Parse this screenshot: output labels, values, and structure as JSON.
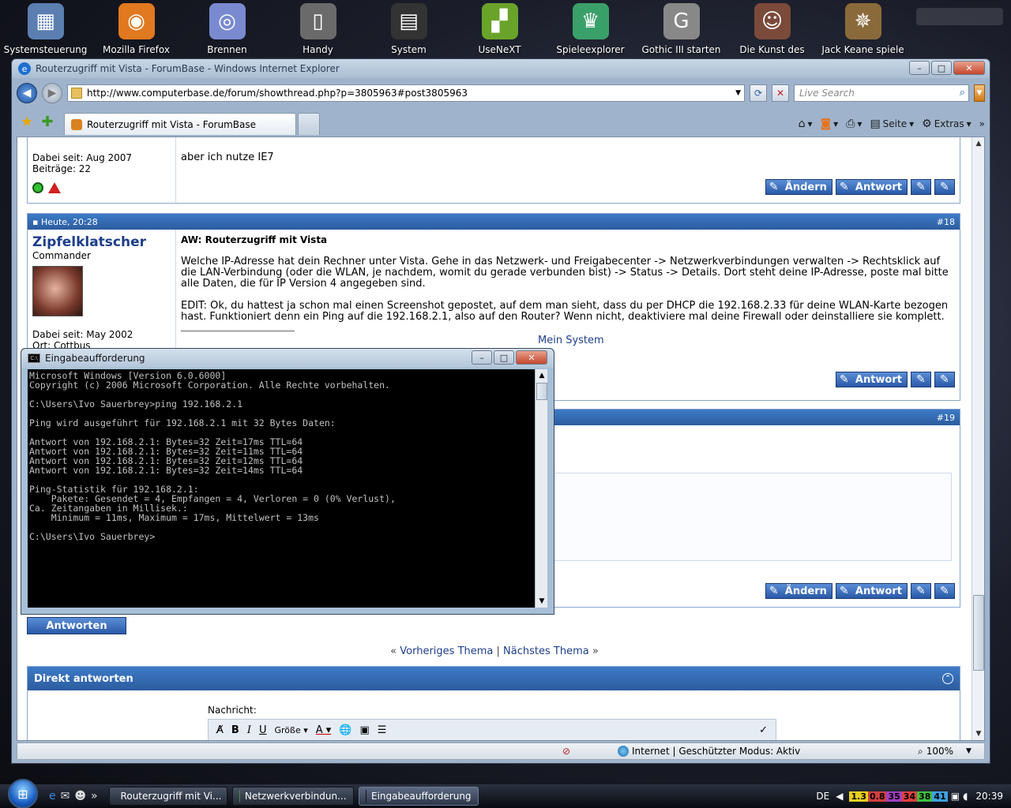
{
  "desktop": {
    "icons": [
      {
        "label": "Systemsteuerung",
        "icon": "control-panel-icon",
        "color": "#5a7fb0",
        "glyph": "▦"
      },
      {
        "label": "Mozilla Firefox",
        "icon": "firefox-icon",
        "color": "#e0791f",
        "glyph": "◉"
      },
      {
        "label": "Brennen",
        "icon": "disc-icon",
        "color": "#7a8ad0",
        "glyph": "◎"
      },
      {
        "label": "Handy",
        "icon": "phone-icon",
        "color": "#6a6a6a",
        "glyph": "▯"
      },
      {
        "label": "System",
        "icon": "chip-icon",
        "color": "#333333",
        "glyph": "▤"
      },
      {
        "label": "UseNeXT",
        "icon": "usenext-icon",
        "color": "#6aa32a",
        "glyph": "▞"
      },
      {
        "label": "Spieleexplorer",
        "icon": "trophy-icon",
        "color": "#3aa06a",
        "glyph": "♛"
      },
      {
        "label": "Gothic III starten",
        "icon": "gothic-icon",
        "color": "#888888",
        "glyph": "G"
      },
      {
        "label": "Die Kunst des",
        "icon": "game-portrait-icon",
        "color": "#7a4a3a",
        "glyph": "☺"
      },
      {
        "label": "Jack Keane spiele",
        "icon": "compass-icon",
        "color": "#8a6a3a",
        "glyph": "✵"
      }
    ]
  },
  "ie": {
    "title": "Routerzugriff mit Vista - ForumBase - Windows Internet Explorer",
    "url": "http://www.computerbase.de/forum/showthread.php?p=3805963#post3805963",
    "search_placeholder": "Live Search",
    "tab_label": "Routerzugriff mit Vista - ForumBase",
    "cmd": {
      "seite": "Seite",
      "extras": "Extras"
    },
    "status": {
      "zone": "Internet | Geschützter Modus: Aktiv",
      "zoom": "100%"
    }
  },
  "forum": {
    "post17": {
      "member_since": "Dabei seit: Aug 2007",
      "posts": "Beiträge: 22",
      "message": "aber ich nutze IE7",
      "btn_edit": "Ändern",
      "btn_reply": "Antwort"
    },
    "post18": {
      "date": "Heute, 20:28",
      "number": "#18",
      "username": "Zipfelklatscher",
      "rank": "Commander",
      "member_since": "Dabei seit: May 2002",
      "location": "Ort: Cottbus",
      "subject": "AW: Routerzugriff mit Vista",
      "para1": "Welche IP-Adresse hat dein Rechner unter Vista. Gehe in das Netzwerk- und Freigabecenter -> Netzwerkverbindungen verwalten -> Rechtsklick auf die LAN-Verbindung (oder die WLAN, je nachdem, womit du gerade verbunden bist) -> Status -> Details. Dort steht deine IP-Adresse, poste mal bitte alle Daten, die für IP Version 4 angegeben sind.",
      "para2": "EDIT: Ok, du hattest ja schon mal einen Screenshot gepostet, auf dem man sieht, dass du per DHCP die 192.168.2.33 für deine WLAN-Karte bezogen hast. Funktioniert denn ein Ping auf die 192.168.2.1, also auf den Router? Wenn nicht, deaktiviere mal deine Firewall oder deinstalliere sie komplett.",
      "sig_link": "Mein System",
      "btn_reply": "Antwort"
    },
    "post19": {
      "number": "#19",
      "btn_edit": "Ändern",
      "btn_reply": "Antwort"
    },
    "antworten": "Antworten",
    "prev_thread": "Vorheriges Thema",
    "next_thread": "Nächstes Thema",
    "direkt_title": "Direkt antworten",
    "nachricht": "Nachricht:",
    "size_label": "Größe"
  },
  "cmd": {
    "title": "Eingabeaufforderung",
    "lines": [
      "Microsoft Windows [Version 6.0.6000]",
      "Copyright (c) 2006 Microsoft Corporation. Alle Rechte vorbehalten.",
      "",
      "C:\\Users\\Ivo Sauerbrey>ping 192.168.2.1",
      "",
      "Ping wird ausgeführt für 192.168.2.1 mit 32 Bytes Daten:",
      "",
      "Antwort von 192.168.2.1: Bytes=32 Zeit=17ms TTL=64",
      "Antwort von 192.168.2.1: Bytes=32 Zeit=11ms TTL=64",
      "Antwort von 192.168.2.1: Bytes=32 Zeit=12ms TTL=64",
      "Antwort von 192.168.2.1: Bytes=32 Zeit=14ms TTL=64",
      "",
      "Ping-Statistik für 192.168.2.1:",
      "    Pakete: Gesendet = 4, Empfangen = 4, Verloren = 0 (0% Verlust),",
      "Ca. Zeitangaben in Millisek.:",
      "    Minimum = 11ms, Maximum = 17ms, Mittelwert = 13ms",
      "",
      "C:\\Users\\Ivo Sauerbrey>"
    ]
  },
  "taskbar": {
    "tasks": [
      {
        "label": "Routerzugriff mit Vi...",
        "color": "#2a6ad0"
      },
      {
        "label": "Netzwerkverbindun...",
        "color": "#4a8a4a"
      },
      {
        "label": "Eingabeaufforderung",
        "color": "#111111"
      }
    ],
    "lang": "DE",
    "tray_nums": [
      {
        "value": "1.3",
        "color": "#e8d020"
      },
      {
        "value": "0.8",
        "color": "#d04040"
      },
      {
        "value": "35",
        "color": "#a040c0"
      },
      {
        "value": "34",
        "color": "#e04040"
      },
      {
        "value": "38",
        "color": "#40c040"
      },
      {
        "value": "41",
        "color": "#40a0e0"
      }
    ],
    "clock": "20:39"
  }
}
